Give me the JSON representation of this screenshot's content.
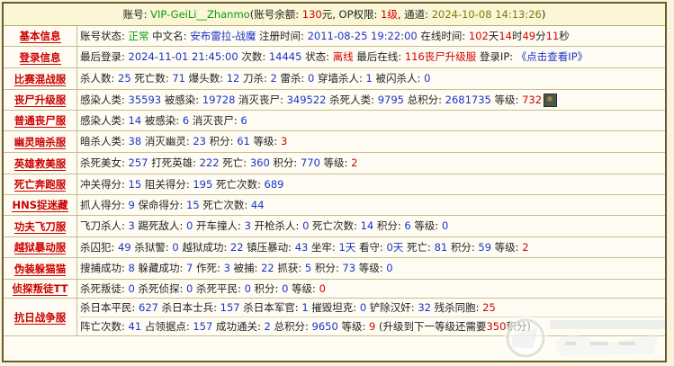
{
  "header": {
    "account_label": "账号: ",
    "account": "VIP-GeiLi__Zhanmo",
    "balance_open": "(账号余额: ",
    "balance": "130",
    "balance_unit": "元, OP权限: ",
    "op": "1级",
    "channel_label": ", 通道: ",
    "time": "2024-10-08 14:13:26",
    "close": ")"
  },
  "rows": [
    {
      "label": "基本信息",
      "lines": [
        [
          {
            "t": "账号状态: "
          },
          {
            "t": "正常",
            "c": "green"
          },
          {
            "t": " 中文名: "
          },
          {
            "t": "安布雷拉-战魔",
            "c": "blue"
          },
          {
            "t": " 注册时间: "
          },
          {
            "t": "2011-08-25 19:22:00",
            "c": "blue"
          },
          {
            "t": " 在线时间: "
          },
          {
            "t": "102",
            "c": "red"
          },
          {
            "t": "天"
          },
          {
            "t": "14",
            "c": "red"
          },
          {
            "t": "时"
          },
          {
            "t": "49",
            "c": "red"
          },
          {
            "t": "分"
          },
          {
            "t": "11",
            "c": "red"
          },
          {
            "t": "秒"
          }
        ]
      ]
    },
    {
      "label": "登录信息",
      "lines": [
        [
          {
            "t": "最后登录: "
          },
          {
            "t": "2024-11-01 21:45:00",
            "c": "blue"
          },
          {
            "t": " 次数: "
          },
          {
            "t": "14445",
            "c": "blue"
          },
          {
            "t": " 状态: "
          },
          {
            "t": "离线",
            "c": "red"
          },
          {
            "t": " 最后在线: "
          },
          {
            "t": "116丧尸升级服",
            "c": "red"
          },
          {
            "t": " 登录IP: "
          },
          {
            "t": "《点击查看IP》",
            "c": "blue"
          }
        ]
      ]
    },
    {
      "label": "比赛混战服",
      "lines": [
        [
          {
            "t": "杀人数: "
          },
          {
            "t": "25",
            "c": "blue"
          },
          {
            "t": " 死亡数: "
          },
          {
            "t": "71",
            "c": "blue"
          },
          {
            "t": " 爆头数: "
          },
          {
            "t": "12",
            "c": "blue"
          },
          {
            "t": " 刀杀: "
          },
          {
            "t": "2",
            "c": "blue"
          },
          {
            "t": " 雷杀: "
          },
          {
            "t": "0",
            "c": "blue"
          },
          {
            "t": " 穿墙杀人: "
          },
          {
            "t": "1",
            "c": "blue"
          },
          {
            "t": " 被闪杀人: "
          },
          {
            "t": "0",
            "c": "blue"
          }
        ]
      ]
    },
    {
      "label": "丧尸升级服",
      "icon": true,
      "lines": [
        [
          {
            "t": "感染人类: "
          },
          {
            "t": "35593",
            "c": "blue"
          },
          {
            "t": " 被感染: "
          },
          {
            "t": "19728",
            "c": "blue"
          },
          {
            "t": " 消灭丧尸: "
          },
          {
            "t": "349522",
            "c": "blue"
          },
          {
            "t": " 杀死人类: "
          },
          {
            "t": "9795",
            "c": "blue"
          },
          {
            "t": " 总积分: "
          },
          {
            "t": "2681735",
            "c": "blue"
          },
          {
            "t": " 等级: "
          },
          {
            "t": "732",
            "c": "red"
          }
        ]
      ]
    },
    {
      "label": "普通丧尸服",
      "lines": [
        [
          {
            "t": "感染人类: "
          },
          {
            "t": "14",
            "c": "blue"
          },
          {
            "t": " 被感染: "
          },
          {
            "t": "6",
            "c": "blue"
          },
          {
            "t": " 消灭丧尸: "
          },
          {
            "t": "6",
            "c": "blue"
          }
        ]
      ]
    },
    {
      "label": "幽灵暗杀服",
      "lines": [
        [
          {
            "t": "暗杀人类: "
          },
          {
            "t": "38",
            "c": "blue"
          },
          {
            "t": " 消灭幽灵: "
          },
          {
            "t": "23",
            "c": "blue"
          },
          {
            "t": " 积分: "
          },
          {
            "t": "61",
            "c": "blue"
          },
          {
            "t": " 等级: "
          },
          {
            "t": "3",
            "c": "red"
          }
        ]
      ]
    },
    {
      "label": "英雄救美服",
      "lines": [
        [
          {
            "t": "杀死美女: "
          },
          {
            "t": "257",
            "c": "blue"
          },
          {
            "t": " 打死英雄: "
          },
          {
            "t": "222",
            "c": "blue"
          },
          {
            "t": " 死亡: "
          },
          {
            "t": "360",
            "c": "blue"
          },
          {
            "t": " 积分: "
          },
          {
            "t": "770",
            "c": "blue"
          },
          {
            "t": " 等级: "
          },
          {
            "t": "2",
            "c": "red"
          }
        ]
      ]
    },
    {
      "label": "死亡奔跑服",
      "lines": [
        [
          {
            "t": "冲关得分: "
          },
          {
            "t": "15",
            "c": "blue"
          },
          {
            "t": " 阻关得分: "
          },
          {
            "t": "195",
            "c": "blue"
          },
          {
            "t": " 死亡次数: "
          },
          {
            "t": "689",
            "c": "blue"
          }
        ]
      ]
    },
    {
      "label": "HNS捉迷藏",
      "lines": [
        [
          {
            "t": "抓人得分: "
          },
          {
            "t": "9",
            "c": "blue"
          },
          {
            "t": " 保命得分: "
          },
          {
            "t": "15",
            "c": "blue"
          },
          {
            "t": " 死亡次数: "
          },
          {
            "t": "44",
            "c": "blue"
          }
        ]
      ]
    },
    {
      "label": "功夫飞刀服",
      "lines": [
        [
          {
            "t": "飞刀杀人: "
          },
          {
            "t": "3",
            "c": "blue"
          },
          {
            "t": " 踢死敌人: "
          },
          {
            "t": "0",
            "c": "blue"
          },
          {
            "t": " 开车撞人: "
          },
          {
            "t": "3",
            "c": "blue"
          },
          {
            "t": " 开枪杀人: "
          },
          {
            "t": "0",
            "c": "blue"
          },
          {
            "t": " 死亡次数: "
          },
          {
            "t": "14",
            "c": "blue"
          },
          {
            "t": " 积分: "
          },
          {
            "t": "6",
            "c": "blue"
          },
          {
            "t": " 等级: "
          },
          {
            "t": "0",
            "c": "blue"
          }
        ]
      ]
    },
    {
      "label": "越狱暴动服",
      "lines": [
        [
          {
            "t": "杀囚犯: "
          },
          {
            "t": "49",
            "c": "blue"
          },
          {
            "t": " 杀狱警: "
          },
          {
            "t": "0",
            "c": "blue"
          },
          {
            "t": " 越狱成功: "
          },
          {
            "t": "22",
            "c": "blue"
          },
          {
            "t": " 镇压暴动: "
          },
          {
            "t": "43",
            "c": "blue"
          },
          {
            "t": " 坐牢: "
          },
          {
            "t": "1天",
            "c": "blue"
          },
          {
            "t": " 看守: "
          },
          {
            "t": "0天",
            "c": "blue"
          },
          {
            "t": " 死亡: "
          },
          {
            "t": "81",
            "c": "blue"
          },
          {
            "t": " 积分: "
          },
          {
            "t": "59",
            "c": "blue"
          },
          {
            "t": " 等级: "
          },
          {
            "t": "2",
            "c": "red"
          }
        ]
      ]
    },
    {
      "label": "伪装躲猫猫",
      "lines": [
        [
          {
            "t": "搜捕成功: "
          },
          {
            "t": "8",
            "c": "blue"
          },
          {
            "t": " 躲藏成功: "
          },
          {
            "t": "7",
            "c": "blue"
          },
          {
            "t": " 作死: "
          },
          {
            "t": "3",
            "c": "blue"
          },
          {
            "t": " 被捕: "
          },
          {
            "t": "22",
            "c": "blue"
          },
          {
            "t": " 抓获: "
          },
          {
            "t": "5",
            "c": "blue"
          },
          {
            "t": " 积分: "
          },
          {
            "t": "73",
            "c": "blue"
          },
          {
            "t": " 等级: "
          },
          {
            "t": "0",
            "c": "blue"
          }
        ]
      ]
    },
    {
      "label": "侦探叛徒TT",
      "lines": [
        [
          {
            "t": "杀死叛徒: "
          },
          {
            "t": "0",
            "c": "blue"
          },
          {
            "t": " 杀死侦探: "
          },
          {
            "t": "0",
            "c": "blue"
          },
          {
            "t": " 杀死平民: "
          },
          {
            "t": "0",
            "c": "blue"
          },
          {
            "t": " 积分: "
          },
          {
            "t": "0",
            "c": "blue"
          },
          {
            "t": " 等级: "
          },
          {
            "t": "0",
            "c": "red"
          }
        ]
      ]
    },
    {
      "label": "抗日战争服",
      "lines": [
        [
          {
            "t": "杀日本平民: "
          },
          {
            "t": "627",
            "c": "blue"
          },
          {
            "t": " 杀日本士兵: "
          },
          {
            "t": "157",
            "c": "blue"
          },
          {
            "t": " 杀日本军官: "
          },
          {
            "t": "1",
            "c": "blue"
          },
          {
            "t": " 摧毁坦克: "
          },
          {
            "t": "0",
            "c": "blue"
          },
          {
            "t": " 铲除汉奸: "
          },
          {
            "t": "32",
            "c": "blue"
          },
          {
            "t": " 残杀同胞: "
          },
          {
            "t": "25",
            "c": "red"
          }
        ],
        [
          {
            "t": "阵亡次数: "
          },
          {
            "t": "41",
            "c": "blue"
          },
          {
            "t": " 占领据点: "
          },
          {
            "t": "157",
            "c": "blue"
          },
          {
            "t": " 成功通关: "
          },
          {
            "t": "2",
            "c": "blue"
          },
          {
            "t": " 总积分: "
          },
          {
            "t": "9650",
            "c": "blue"
          },
          {
            "t": " 等级: "
          },
          {
            "t": "9",
            "c": "red"
          },
          {
            "t": " (升级到下一等级还需要"
          },
          {
            "t": "350",
            "c": "red"
          },
          {
            "t": "积分)"
          }
        ]
      ]
    }
  ]
}
